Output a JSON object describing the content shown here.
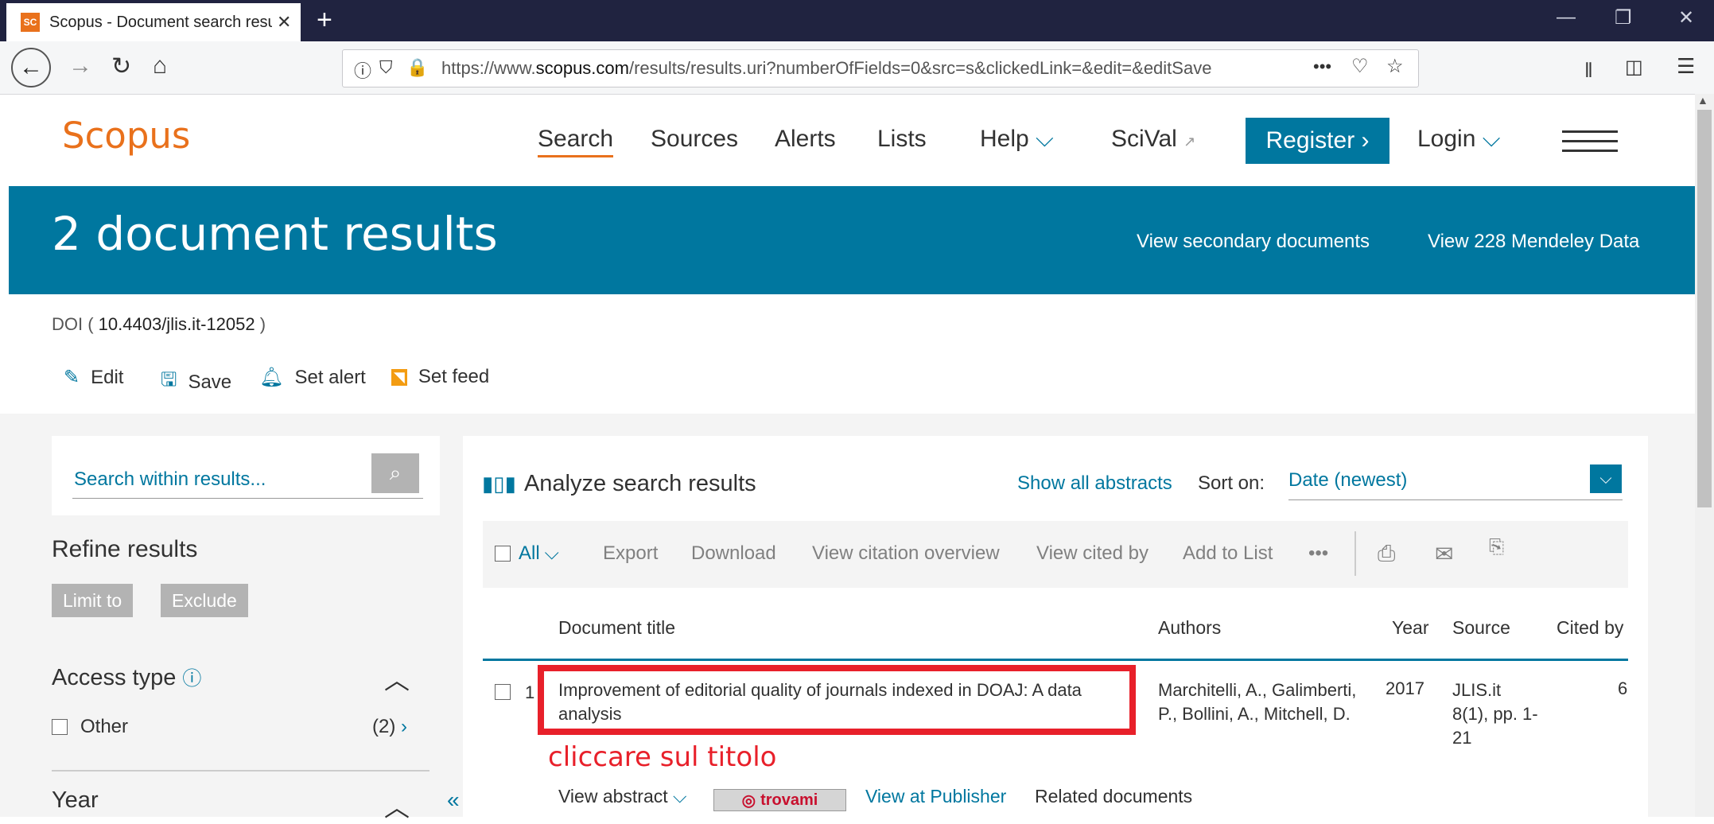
{
  "browser": {
    "tab_title": "Scopus - Document search resu",
    "favicon_text": "SC",
    "tab_close": "✕",
    "new_tab": "+",
    "win_minimize": "—",
    "win_restore": "❐",
    "win_close": "✕",
    "url_prefix": "https://www.",
    "url_domain": "scopus.com",
    "url_rest": "/results/results.uri?numberOfFields=0&src=s&clickedLink=&edit=&editSave",
    "url_more": "•••"
  },
  "header": {
    "logo": "Scopus",
    "nav": {
      "search": "Search",
      "sources": "Sources",
      "alerts": "Alerts",
      "lists": "Lists",
      "help": "Help",
      "scival": "SciVal"
    },
    "register": "Register",
    "login": "Login"
  },
  "banner": {
    "title": "2 document results",
    "secondary": "View secondary documents",
    "mendeley": "View 228 Mendeley Data"
  },
  "query": {
    "prefix": "DOI ( ",
    "doi": "10.4403/jlis.it-12052",
    "suffix": " )"
  },
  "actions": {
    "edit": "Edit",
    "save": "Save",
    "set_alert": "Set alert",
    "set_feed": "Set feed"
  },
  "sidebar": {
    "search_placeholder": "Search within results...",
    "refine_title": "Refine results",
    "limit_to": "Limit to",
    "exclude": "Exclude",
    "access_type": "Access type",
    "other_label": "Other",
    "other_count": "(2)",
    "year_title": "Year"
  },
  "results": {
    "analyze": "Analyze search results",
    "show_abstracts": "Show all abstracts",
    "sort_label": "Sort on:",
    "sort_value": "Date (newest)",
    "toolbar": {
      "all": "All",
      "export": "Export",
      "download": "Download",
      "citation_overview": "View citation overview",
      "cited_by": "View cited by",
      "add_to_list": "Add to List",
      "more": "•••"
    },
    "columns": {
      "title": "Document title",
      "authors": "Authors",
      "year": "Year",
      "source": "Source",
      "cited_by": "Cited by"
    },
    "rows": [
      {
        "num": "1",
        "title": "Improvement of editorial quality of journals indexed in DOAJ: A data analysis",
        "authors": "Marchitelli, A., Galimberti, P., Bollini, A., Mitchell, D.",
        "year": "2017",
        "source": "JLIS.it 8(1), pp. 1-21",
        "cited_by": "6",
        "view_abstract": "View abstract",
        "trovami": "trovami",
        "view_publisher": "View at Publisher",
        "related": "Related documents"
      }
    ]
  },
  "annotation": "cliccare sul titolo",
  "colors": {
    "accent": "#00779f",
    "brand": "#e9711c",
    "highlight": "#e8202a"
  }
}
